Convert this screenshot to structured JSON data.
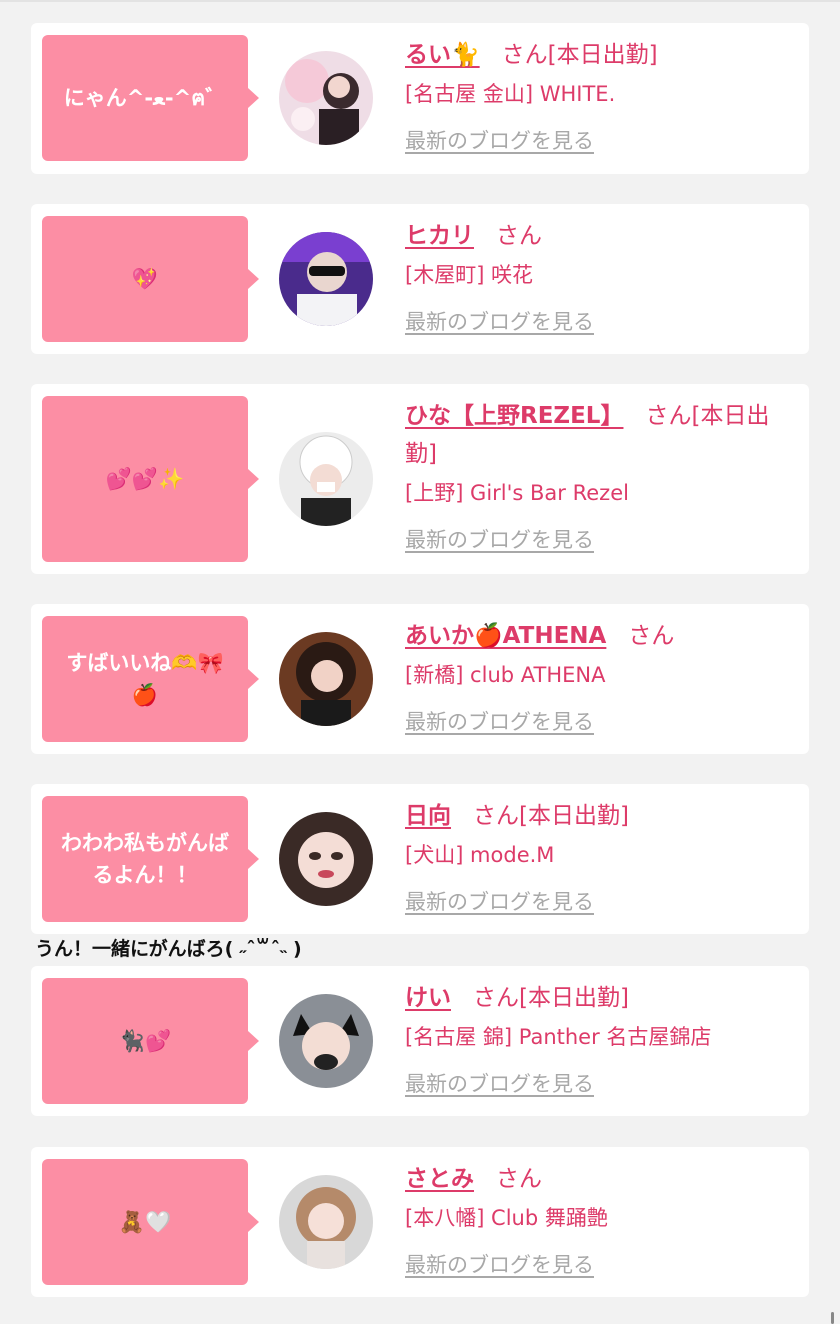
{
  "entries": [
    {
      "comment": "にゃん^-ﻌ-^ฅ゛",
      "name": "るい🐈",
      "honorific": "さん",
      "status": "[本日出勤]",
      "shop": "[名古屋 金山] WHITE.",
      "blog_link": "最新のブログを見る"
    },
    {
      "comment": "💖",
      "name": "ヒカリ",
      "honorific": "さん",
      "status": "",
      "shop": "[木屋町] 咲花",
      "blog_link": "最新のブログを見る"
    },
    {
      "comment": "💕💕✨",
      "name": "ひな【上野REZEL】",
      "honorific": "さん",
      "status": "[本日出勤]",
      "shop": "[上野] Girl's Bar Rezel",
      "blog_link": "最新のブログを見る"
    },
    {
      "comment": "すばいいね🫶🎀🍎",
      "name": "あいか🍎ATHENA",
      "honorific": "さん",
      "status": "",
      "shop": "[新橋] club ATHENA",
      "blog_link": "最新のブログを見る"
    },
    {
      "comment": "わわわ私もがんばるよん！！",
      "name": "日向",
      "honorific": "さん",
      "status": "[本日出勤]",
      "shop": "[犬山] mode.M",
      "blog_link": "最新のブログを見る"
    },
    {
      "comment": "🐈‍⬛💕",
      "name": "けい",
      "honorific": "さん",
      "status": "[本日出勤]",
      "shop": "[名古屋 錦] Panther 名古屋錦店",
      "blog_link": "最新のブログを見る"
    },
    {
      "comment": "🧸🤍",
      "name": "さとみ",
      "honorific": "さん",
      "status": "",
      "shop": "[本八幡] Club 舞踊艶",
      "blog_link": "最新のブログを見る"
    }
  ],
  "reply_text": "うん！一緒にがんばろ( ˶ˆ꒳ˆ˵ )",
  "colors": {
    "accent": "#dd3b69",
    "bubble": "#fc8ea4",
    "muted": "#a8a8a8",
    "background": "#f2f2f2"
  }
}
